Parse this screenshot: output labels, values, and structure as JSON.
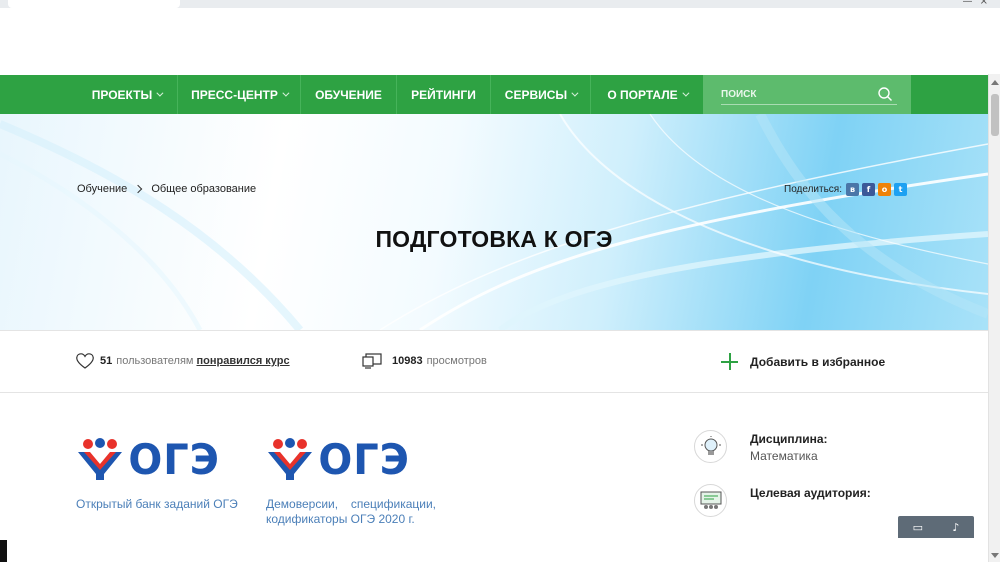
{
  "nav": {
    "items": [
      {
        "label": "ПРОЕКТЫ",
        "dropdown": true
      },
      {
        "label": "ПРЕСС-ЦЕНТР",
        "dropdown": true
      },
      {
        "label": "ОБУЧЕНИЕ",
        "dropdown": false
      },
      {
        "label": "РЕЙТИНГИ",
        "dropdown": false
      },
      {
        "label": "СЕРВИСЫ",
        "dropdown": true
      },
      {
        "label": "О ПОРТАЛЕ",
        "dropdown": true
      }
    ],
    "search_placeholder": "ПОИСК"
  },
  "breadcrumb": {
    "items": [
      "Обучение",
      "Общее образование"
    ]
  },
  "share": {
    "label": "Поделиться:",
    "networks": [
      "vk",
      "facebook",
      "odnoklassniki",
      "twitter"
    ]
  },
  "hero": {
    "title": "ПОДГОТОВКА К ОГЭ"
  },
  "stats": {
    "likes_count": "51",
    "likes_text": "пользователям",
    "likes_link": "понравился курс",
    "views_count": "10983",
    "views_text": "просмотров",
    "favorite_label": "Добавить в избранное"
  },
  "cards": [
    {
      "logo_text": "ОГЭ",
      "caption": "Открытый банк заданий ОГЭ"
    },
    {
      "logo_text": "ОГЭ",
      "caption": "Демоверсии, спецификации, кодификаторы ОГЭ 2020 г."
    }
  ],
  "meta": {
    "discipline_label": "Дисциплина:",
    "discipline_value": "Математика",
    "audience_label": "Целевая аудитория:"
  },
  "colors": {
    "nav_green": "#2ea243",
    "search_green": "#5dbb6d",
    "logo_blue": "#1e56b0",
    "logo_red": "#e8322b",
    "link_blue": "#4b7fb8"
  }
}
